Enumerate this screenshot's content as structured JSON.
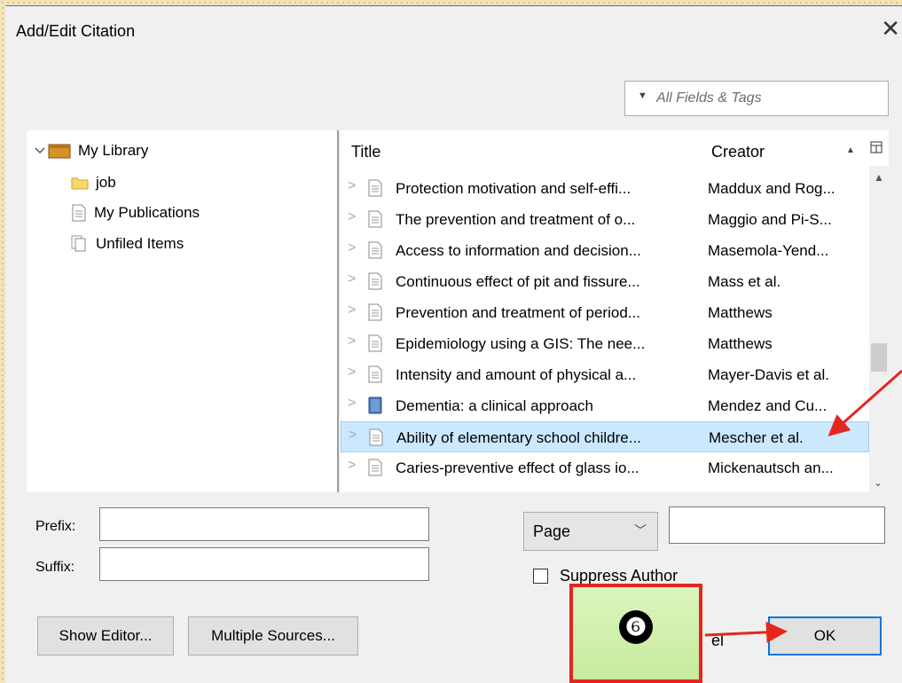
{
  "dialog": {
    "title": "Add/Edit Citation",
    "close_glyph": "✕"
  },
  "search": {
    "placeholder": "All Fields & Tags",
    "dropdown_glyph": "▼"
  },
  "library_tree": {
    "root": "My Library",
    "children": [
      "job",
      "My Publications",
      "Unfiled Items"
    ]
  },
  "items_table": {
    "columns": [
      "Title",
      "Creator"
    ],
    "rows": [
      {
        "title": "Protection motivation and self-effi...",
        "creator": "Maddux and Rog...",
        "icon": "document-icon"
      },
      {
        "title": "The prevention and treatment of o...",
        "creator": "Maggio and Pi-S...",
        "icon": "document-icon"
      },
      {
        "title": "Access to information and decision...",
        "creator": "Masemola-Yend...",
        "icon": "document-icon"
      },
      {
        "title": "Continuous effect of pit and fissure...",
        "creator": "Mass et al.",
        "icon": "document-icon"
      },
      {
        "title": "Prevention and treatment of period...",
        "creator": "Matthews",
        "icon": "document-icon"
      },
      {
        "title": "Epidemiology using a GIS: The nee...",
        "creator": "Matthews",
        "icon": "document-icon"
      },
      {
        "title": "Intensity and amount of physical a...",
        "creator": "Mayer-Davis et al.",
        "icon": "document-icon"
      },
      {
        "title": "Dementia: a clinical approach",
        "creator": "Mendez and Cu...",
        "icon": "book-icon"
      },
      {
        "title": "Ability of elementary school childre...",
        "creator": "Mescher et al.",
        "icon": "document-icon",
        "selected": true
      },
      {
        "title": "Caries-preventive effect of glass io...",
        "creator": "Mickenautsch an...",
        "icon": "document-icon"
      }
    ]
  },
  "form": {
    "prefix_label": "Prefix:",
    "suffix_label": "Suffix:",
    "prefix_value": "",
    "suffix_value": "",
    "locator_type": "Page",
    "locator_value": "",
    "suppress_author_label": "Suppress Author",
    "suppress_author_checked": false
  },
  "buttons": {
    "show_editor": "Show Editor...",
    "multiple_sources": "Multiple Sources...",
    "cancel_fragment": "el",
    "ok": "OK"
  },
  "annotation": {
    "step_number": "❻",
    "arrow_color": "#e5261e"
  }
}
